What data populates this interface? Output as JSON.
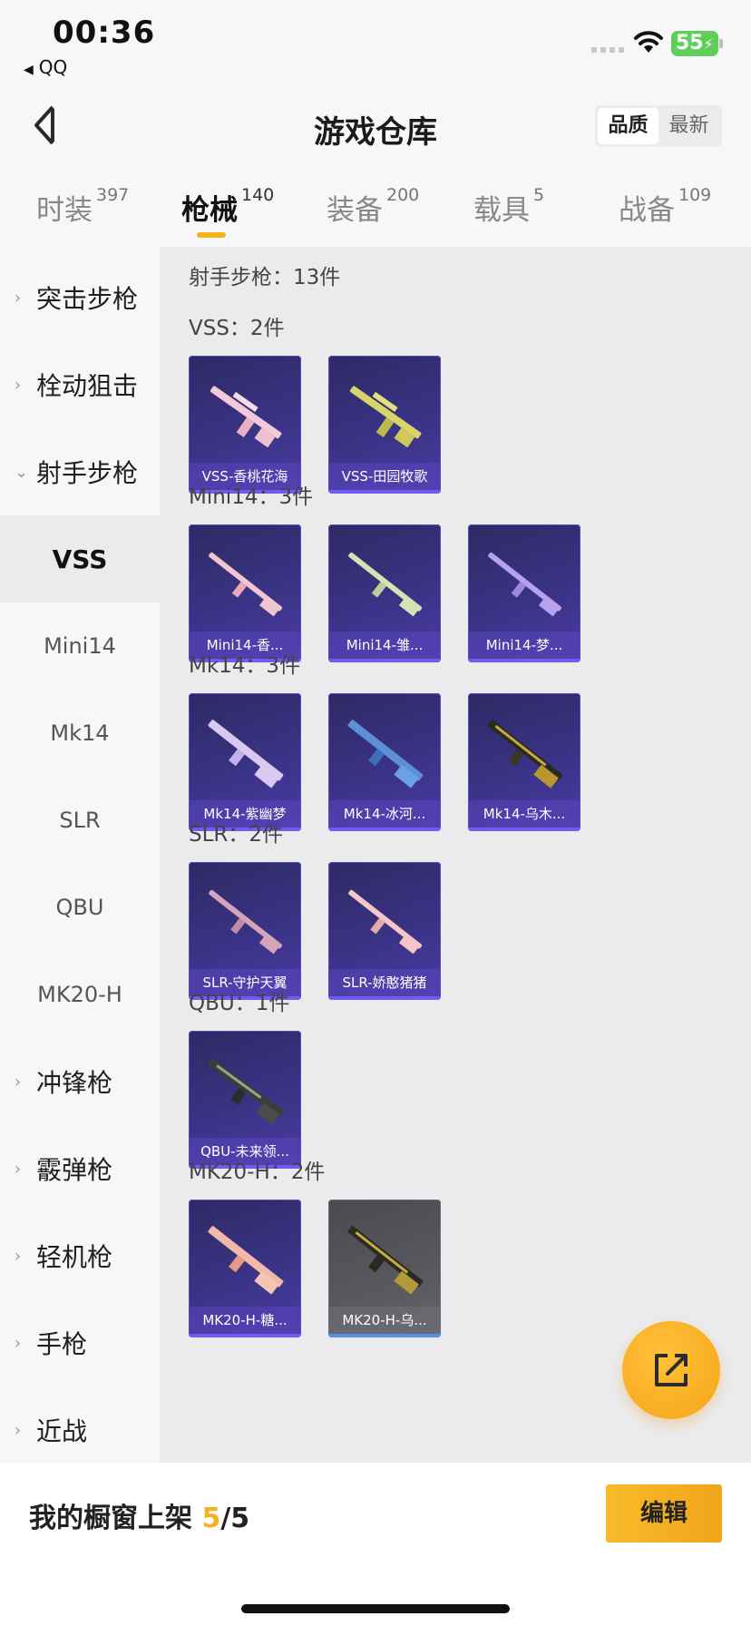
{
  "status_bar": {
    "time": "00:36",
    "back_app": "QQ",
    "battery": "55"
  },
  "header": {
    "title": "游戏仓库",
    "sort_options": [
      "品质",
      "最新"
    ]
  },
  "tabs": [
    {
      "label": "时装",
      "count": "397"
    },
    {
      "label": "枪械",
      "count": "140",
      "active": true
    },
    {
      "label": "装备",
      "count": "200"
    },
    {
      "label": "载具",
      "count": "5"
    },
    {
      "label": "战备",
      "count": "109"
    }
  ],
  "sidebar": {
    "categories": [
      "突击步枪",
      "栓动狙击",
      "射手步枪",
      "冲锋枪",
      "霰弹枪",
      "轻机枪",
      "手枪",
      "近战"
    ],
    "subitems": [
      "VSS",
      "Mini14",
      "Mk14",
      "SLR",
      "QBU",
      "MK20-H"
    ]
  },
  "content": {
    "summary": "射手步枪：13件",
    "groups": [
      {
        "title": "VSS：2件",
        "items": [
          "VSS-香桃花海",
          "VSS-田园牧歌"
        ]
      },
      {
        "title": "Mini14：3件",
        "items": [
          "Mini14-香...",
          "Mini14-雏...",
          "Mini14-梦..."
        ]
      },
      {
        "title": "Mk14：3件",
        "items": [
          "Mk14-紫幽梦",
          "Mk14-冰河...",
          "Mk14-乌木..."
        ]
      },
      {
        "title": "SLR：2件",
        "items": [
          "SLR-守护天翼",
          "SLR-娇憨猪猪"
        ]
      },
      {
        "title": "QBU：1件",
        "items": [
          "QBU-未来领..."
        ]
      },
      {
        "title": "MK20-H：2件",
        "items": [
          "MK20-H-糖...",
          "MK20-H-乌..."
        ]
      }
    ]
  },
  "bottom_bar": {
    "shelf_label": "我的橱窗上架 ",
    "shelf_current": "5",
    "shelf_total": "/5",
    "edit_label": "编辑"
  },
  "colors": {
    "accent": "#f5b21f",
    "card_purple": "#3a3386",
    "card_grey": "#58585e"
  }
}
